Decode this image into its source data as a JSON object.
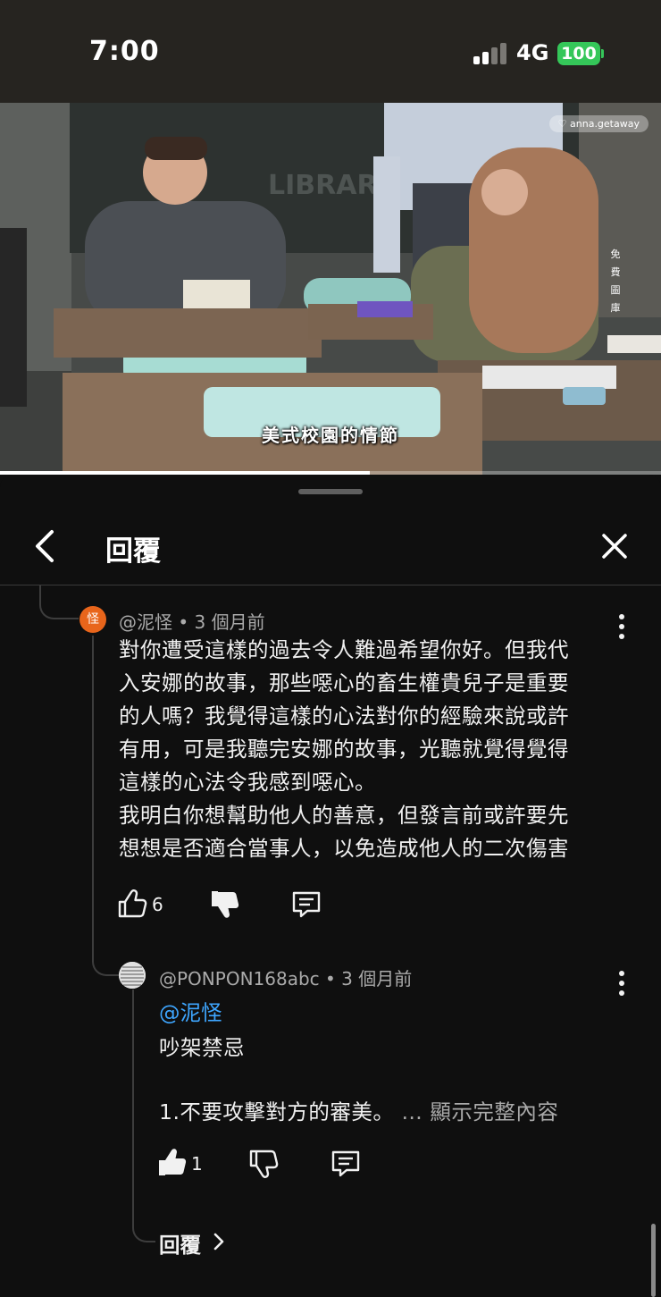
{
  "status_bar": {
    "time": "7:00",
    "network": "4G",
    "battery": "100"
  },
  "video": {
    "subtitle": "美式校園的情節",
    "watermark": "♡ anna.getaway",
    "side_text": [
      "免",
      "費",
      "圖",
      "庫"
    ],
    "progress_percent": 56,
    "scene_sign": "LIBRARY"
  },
  "panel": {
    "title": "回覆"
  },
  "parent_comment": {
    "author": "@泥怪",
    "time": "• 3 個月前",
    "avatar_letter": "怪",
    "lines": [
      "對你遭受這樣的過去令人難過希望你好。但我代",
      "入安娜的故事，那些噁心的畜生權貴兒子是重要",
      "的人嗎？我覺得這樣的心法對你的經驗來說或許",
      "有用，可是我聽完安娜的故事，光聽就覺得覺得",
      "這樣的心法令我感到噁心。",
      "我明白你想幫助他人的善意，但發言前或許要先",
      "想想是否適合當事人，以免造成他人的二次傷害"
    ],
    "likes": "6"
  },
  "reply": {
    "author": "@PONPON168abc",
    "time": "• 3 個月前",
    "mention": "@泥怪",
    "line1": "吵架禁忌",
    "line2": "1.不要攻擊對方的審美。",
    "show_more": " … 顯示完整內容",
    "likes": "1"
  },
  "replies_link": {
    "label": "回覆"
  },
  "colors": {
    "accent_link": "#3ea6ff",
    "avatar": "#e8651b",
    "battery": "#35c759"
  }
}
